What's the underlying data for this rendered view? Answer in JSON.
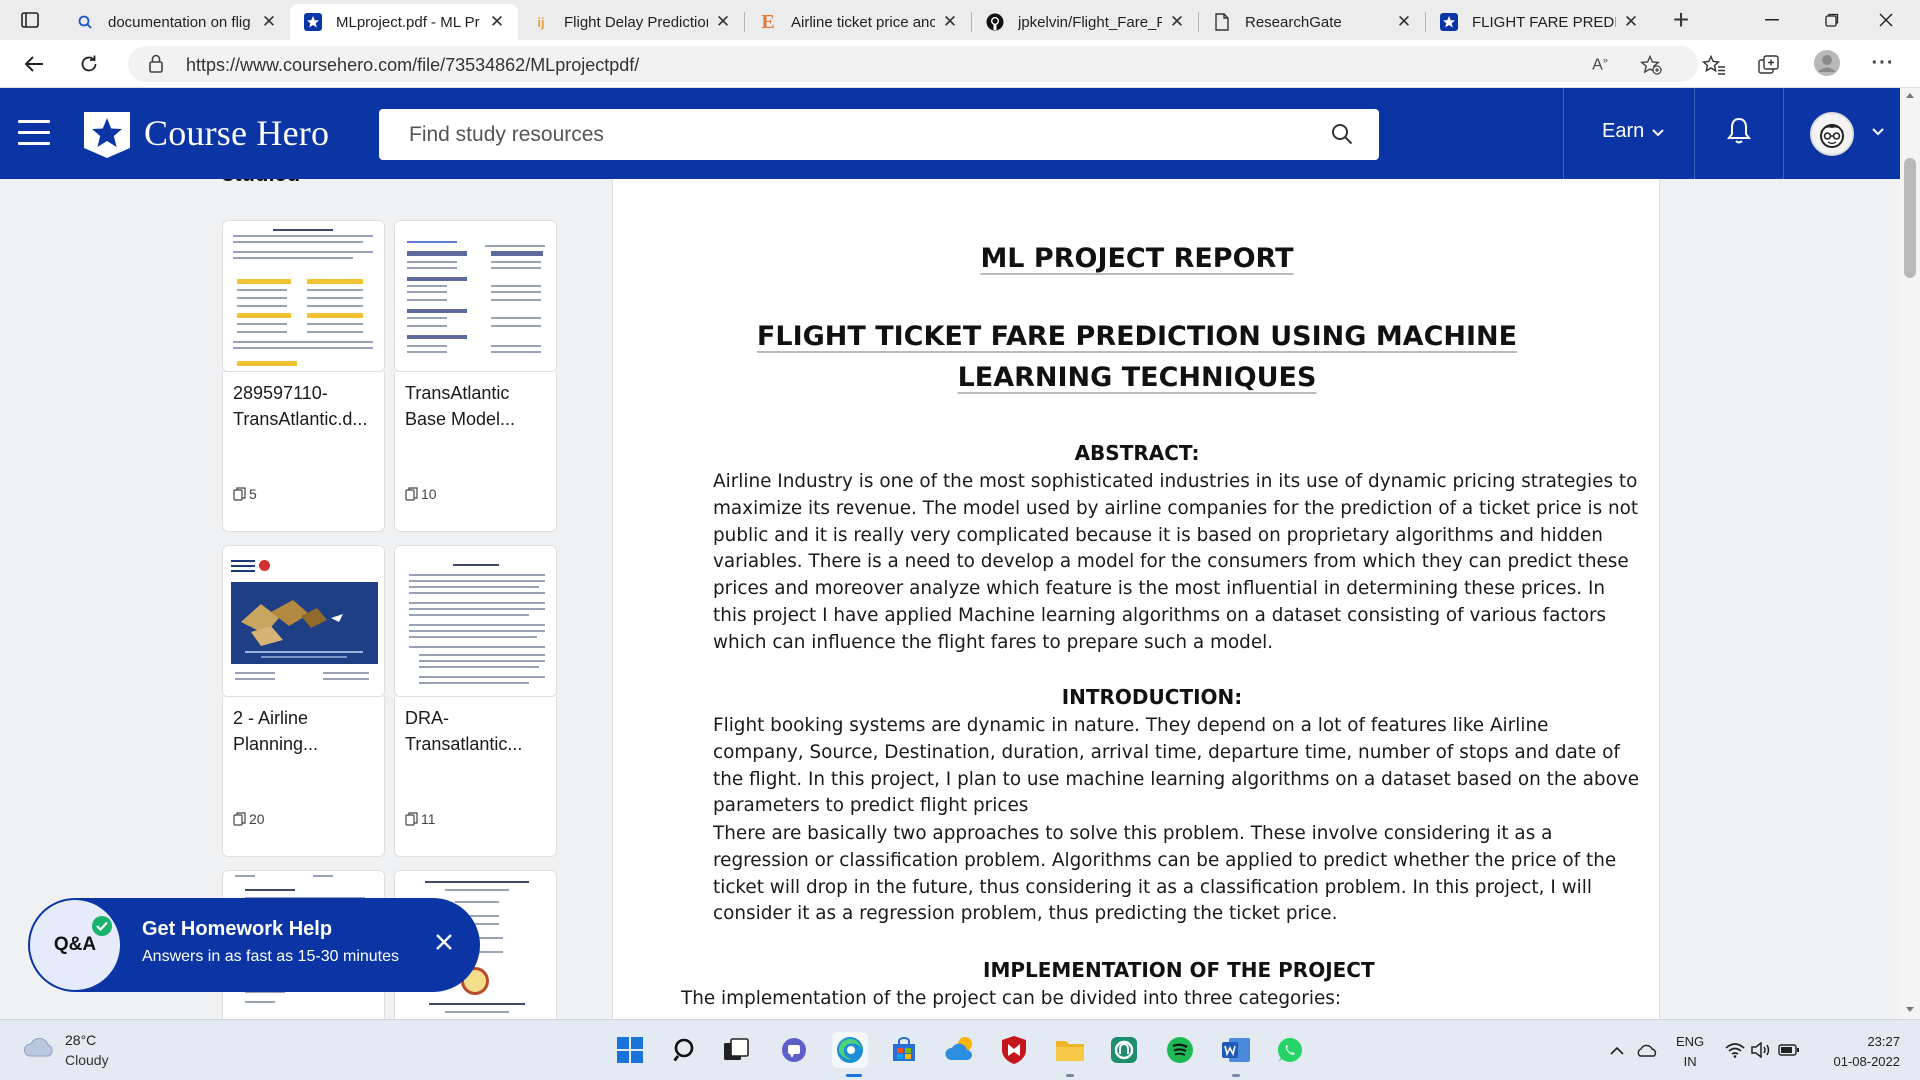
{
  "browser": {
    "tabs": [
      {
        "title": "documentation on flig",
        "favicon": "search-icon"
      },
      {
        "title": "MLproject.pdf - ML Pr",
        "favicon": "coursehero-icon",
        "active": true
      },
      {
        "title": "Flight Delay Predictior",
        "favicon": "kaggle-like-icon"
      },
      {
        "title": "Airline ticket price anc",
        "favicon": "e-icon"
      },
      {
        "title": "jpkelvin/Flight_Fare_P",
        "favicon": "github-icon"
      },
      {
        "title": "ResearchGate",
        "favicon": "page-icon"
      },
      {
        "title": "FLIGHT FARE PREDICT",
        "favicon": "coursehero-icon"
      }
    ],
    "url": "https://www.coursehero.com/file/73534862/MLprojectpdf/"
  },
  "header": {
    "brand": "Course Hero",
    "search_placeholder": "Find study resources",
    "earn_label": "Earn"
  },
  "sidebar": {
    "partial_heading": "studied",
    "cards": [
      {
        "title": "289597110-TransAtlantic.d...",
        "count": "5"
      },
      {
        "title": "TransAtlantic Base Model...",
        "count": "10"
      },
      {
        "title": "2 - Airline Planning...",
        "count": "20"
      },
      {
        "title": "DRA-Transatlantic...",
        "count": "11"
      }
    ]
  },
  "document": {
    "report_title": "ML PROJECT REPORT",
    "main_title": "FLIGHT TICKET FARE PREDICTION USING MACHINE LEARNING TECHNIQUES",
    "abstract_heading": "ABSTRACT:",
    "abstract_text": "Airline Industry is one of the most sophisticated industries in its use of dynamic pricing strategies to maximize its revenue. The model used by airline companies for the prediction of a ticket price is not public and it is really very complicated because it is based on proprietary algorithms and hidden variables. There is a need to develop a model for the consumers from which they can predict these prices and moreover analyze which feature is the most influential in determining these prices. In this project I have applied Machine learning algorithms on a dataset consisting of various factors which can influence the flight fares to prepare such a model.",
    "intro_heading": "INTRODUCTION:",
    "intro_text_1": "Flight booking systems are dynamic in nature. They depend on a lot of features like Airline company, Source, Destination, duration, arrival time, departure time, number of stops and date of the flight. In this project, I plan to use machine learning algorithms on a dataset based on the above parameters to predict flight prices",
    "intro_text_2": "There are basically two approaches to solve this problem. These involve considering it as a regression or classification problem. Algorithms can be applied to predict whether the price of the ticket will drop in the future, thus considering it as a classification problem. In this project, I will consider it as a regression problem, thus predicting the ticket price.",
    "impl_heading": "IMPLEMENTATION OF THE PROJECT",
    "impl_text": "The implementation of the project can be divided into three categories:"
  },
  "promo": {
    "badge": "Q&A",
    "title": "Get Homework Help",
    "subtitle": "Answers in as fast as 15-30 minutes"
  },
  "taskbar": {
    "temperature": "28°C",
    "condition": "Cloudy",
    "lang_1": "ENG",
    "lang_2": "IN",
    "time": "23:27",
    "date": "01-08-2022"
  }
}
